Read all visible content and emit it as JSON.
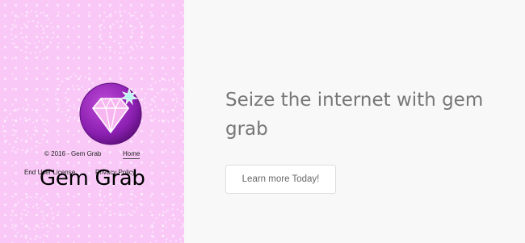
{
  "brand": {
    "name": "Gem Grab",
    "logo_icon": "diamond-gem-icon",
    "accent_color": "#8a1fb0",
    "panel_color": "#f9c8f7"
  },
  "footer": {
    "copyright": "© 2016 - Gem Grab",
    "links": {
      "home": "Home",
      "eula": "End User License",
      "privacy": "Privacy Policy"
    }
  },
  "hero": {
    "headline": "Seize the internet with gem grab",
    "cta_label": "Learn more Today!"
  }
}
